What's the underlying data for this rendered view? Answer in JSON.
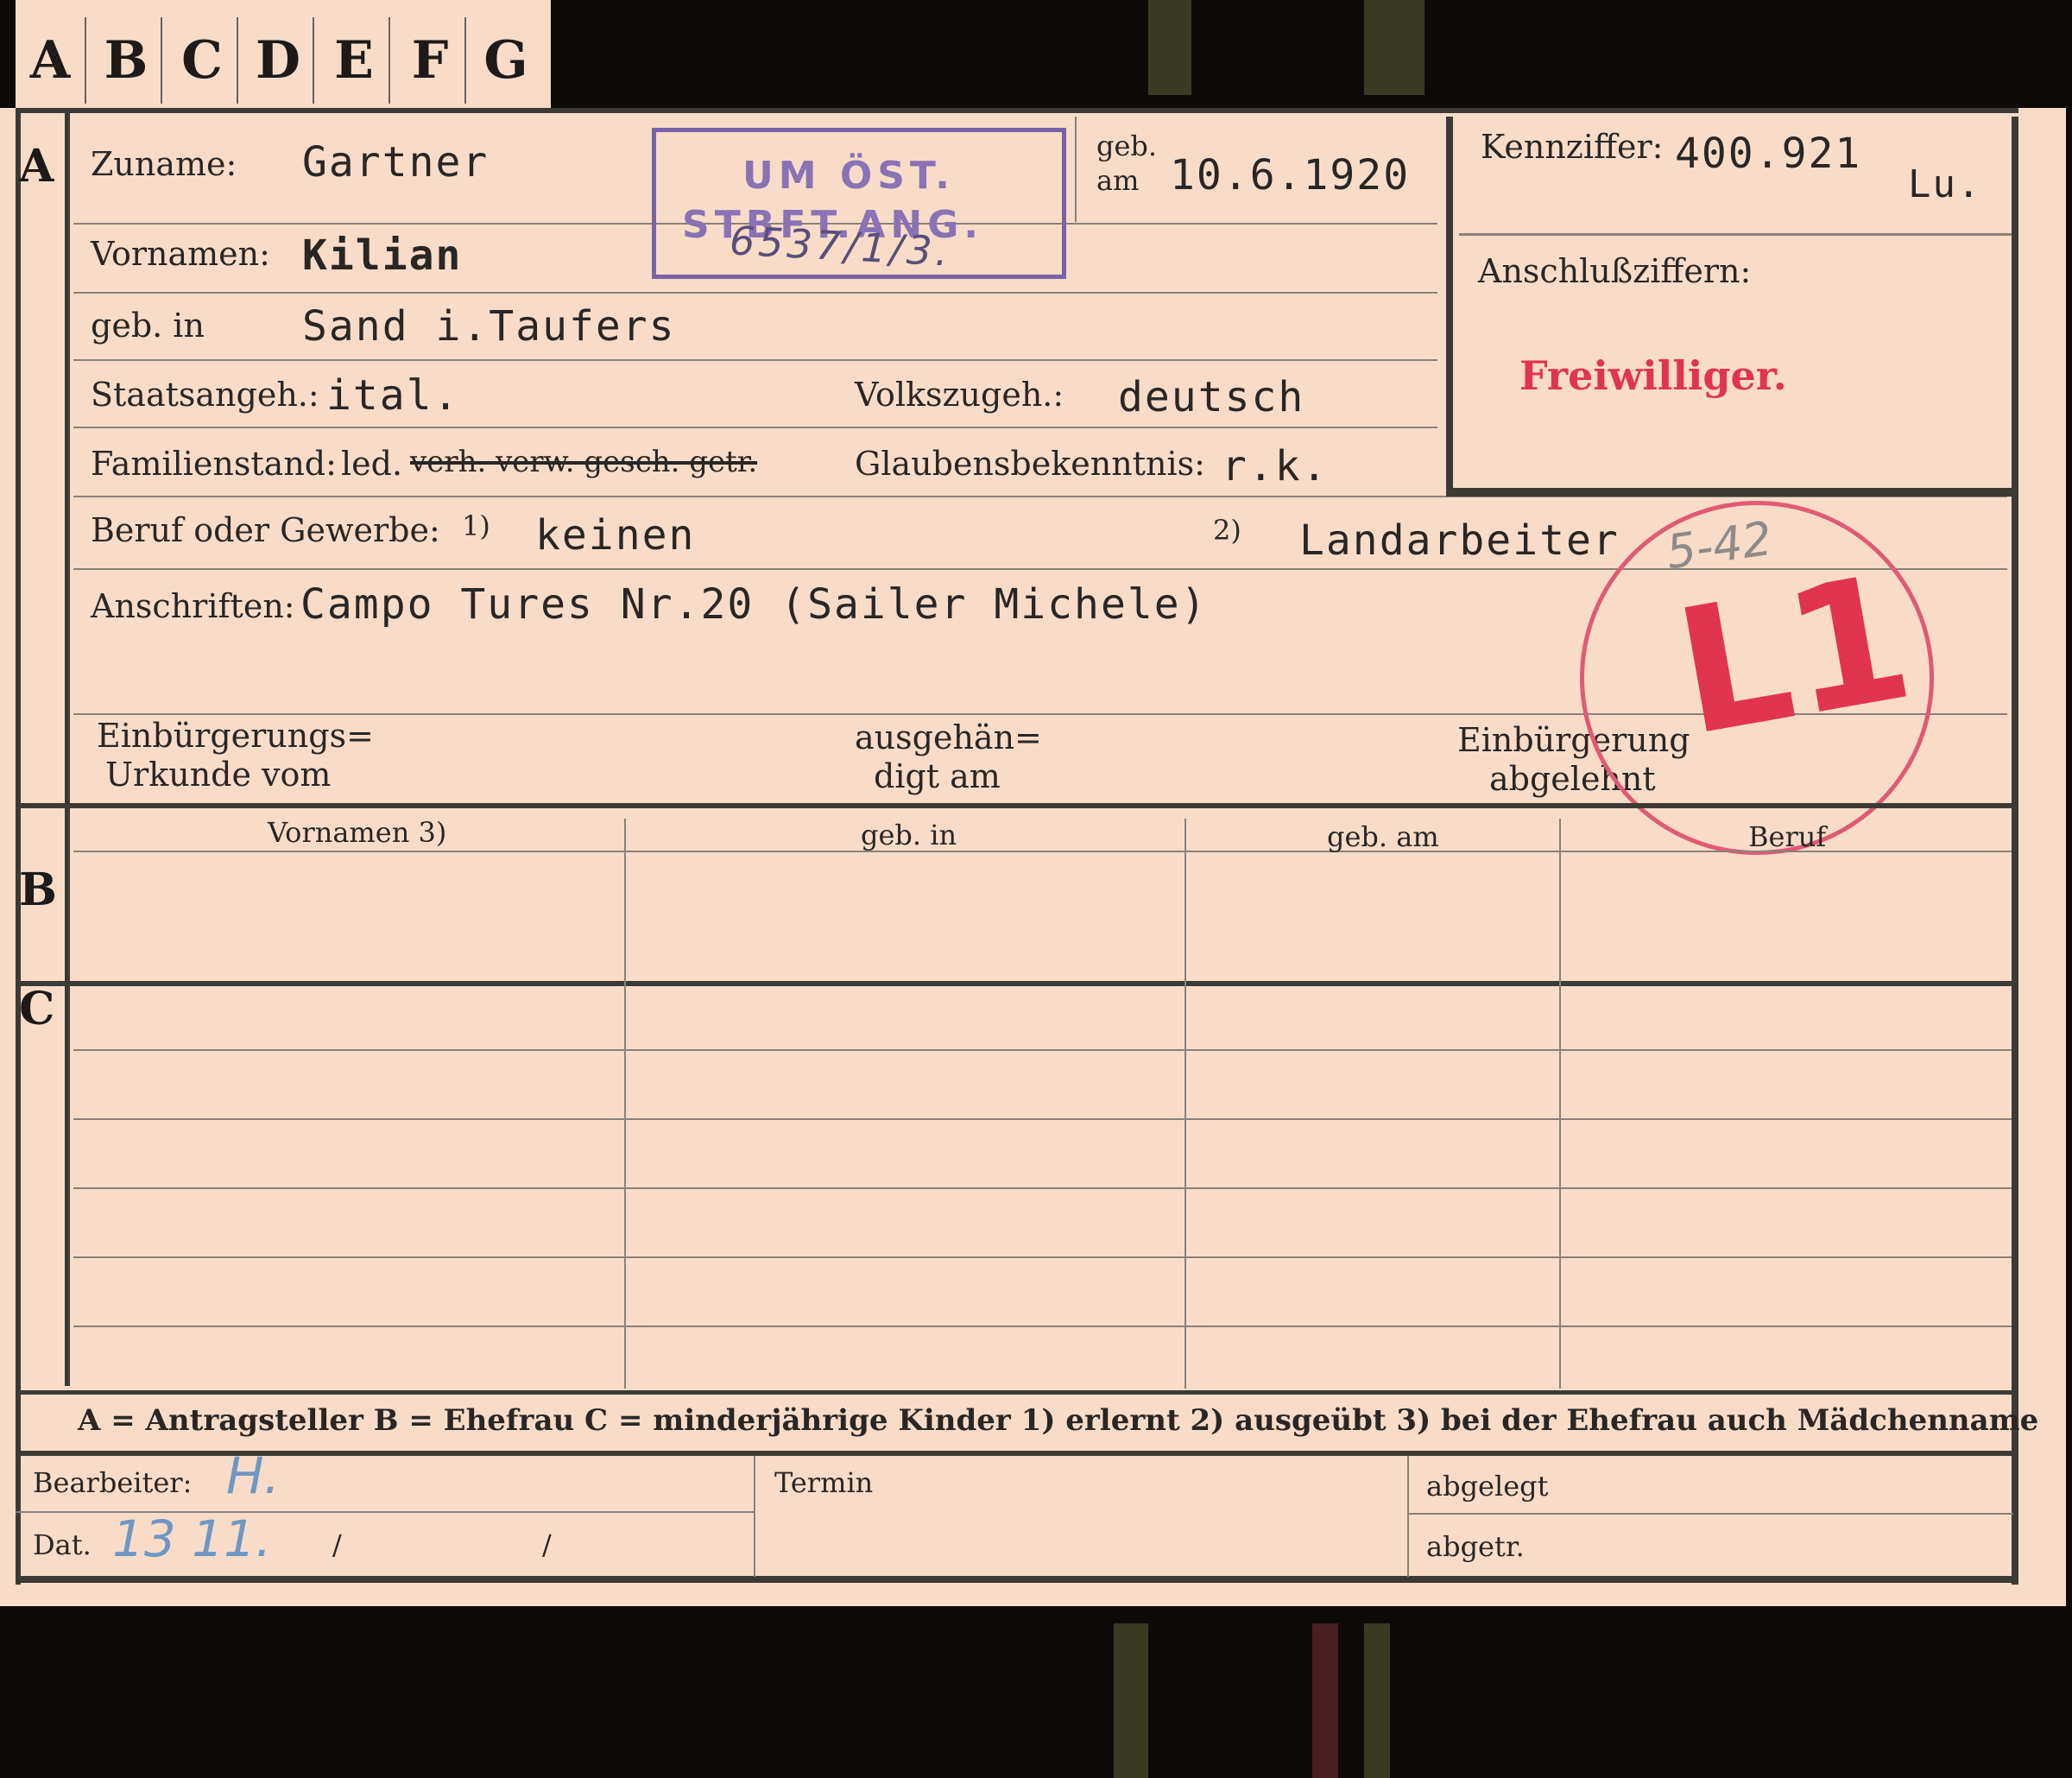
{
  "tabs": [
    "A",
    "B",
    "C",
    "D",
    "E",
    "F",
    "G"
  ],
  "sections": {
    "a": "A",
    "b": "B",
    "c": "C"
  },
  "labels": {
    "zuname": "Zuname:",
    "vornamen": "Vornamen:",
    "geb_in": "geb. in",
    "geb": "geb.",
    "am": "am",
    "staatsangeh": "Staatsangeh.:",
    "volkszugeh": "Volkszugeh.:",
    "familienstand": "Familienstand:",
    "familienstand_options_prefix": "led.",
    "familienstand_struck": "verh. verw. gesch. getr.",
    "glaubensbekenntnis": "Glaubensbekenntnis:",
    "beruf": "Beruf oder Gewerbe:",
    "fn1": "1)",
    "fn2": "2)",
    "anschriften": "Anschriften:",
    "kennziffer": "Kennziffer:",
    "anschlussziffern": "Anschlußziffern:",
    "einbuergerungs_line1": "Einbürgerungs=",
    "einbuergerungs_line2": "Urkunde vom",
    "ausgehaen_line1": "ausgehän=",
    "ausgehaen_line2": "digt am",
    "abgelehnt_line1": "Einbürgerung",
    "abgelehnt_line2": "abgelehnt"
  },
  "values": {
    "zuname": "Gartner",
    "vornamen": "Kilian",
    "geb_in": "Sand i.Taufers",
    "geb_am": "10.6.1920",
    "staatsangeh": "ital.",
    "volkszugeh": "deutsch",
    "glaubensbekenntnis": "r.k.",
    "beruf_erlernt": "keinen",
    "beruf_ausgeuebt": "Landarbeiter",
    "anschrift": "Campo Tures Nr.20 (Sailer Michele)",
    "kennziffer": "400.921",
    "kennziffer_suffix": "Lu.",
    "freiwilliger": "Freiwilliger."
  },
  "stamp": {
    "line1": "UM ÖST.",
    "line2": "STBFT.ANG.",
    "handwritten": "6537/1/3."
  },
  "circle_stamp": {
    "number": "5-42",
    "code": "L1"
  },
  "table_headers": [
    "Vornamen 3)",
    "geb. in",
    "geb. am",
    "Beruf"
  ],
  "legend": "A = Antragsteller   B = Ehefrau   C = minderjährige Kinder   1) erlernt   2) ausgeübt   3) bei der Ehefrau auch Mädchenname",
  "footer": {
    "bearbeiter": "Bearbeiter:",
    "dat": "Dat.",
    "termin": "Termin",
    "abgelegt": "abgelegt",
    "abgetr": "abgetr.",
    "bearbeiter_initial": "H.",
    "date_handwritten": "13 11.",
    "slash1": "/",
    "slash2": "/"
  }
}
